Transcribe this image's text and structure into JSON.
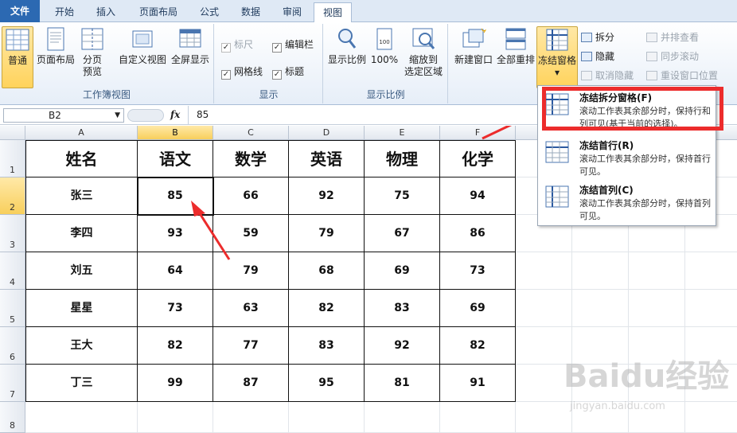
{
  "tabs": {
    "file": "文件",
    "items": [
      "开始",
      "插入",
      "页面布局",
      "公式",
      "数据",
      "审阅",
      "视图"
    ]
  },
  "ribbon": {
    "workbook_views": {
      "normal": "普通",
      "page_layout": "页面布局",
      "page_break_1": "分页",
      "page_break_2": "预览",
      "custom_views": "自定义视图",
      "full_screen": "全屏显示",
      "group_label": "工作簿视图"
    },
    "show": {
      "ruler": "标尺",
      "formula_bar": "编辑栏",
      "gridlines": "网格线",
      "headings": "标题",
      "group_label": "显示"
    },
    "zoom": {
      "zoom": "显示比例",
      "zoom100": "100%",
      "zoom_sel_1": "缩放到",
      "zoom_sel_2": "选定区域",
      "group_label": "显示比例"
    },
    "window": {
      "new_window": "新建窗口",
      "arrange_all": "全部重排",
      "freeze": "冻结窗格",
      "split": "拆分",
      "hide": "隐藏",
      "unhide": "取消隐藏",
      "side_by_side": "并排查看",
      "sync_scroll": "同步滚动",
      "reset_pos": "重设窗口位置"
    }
  },
  "formula_bar": {
    "name_box": "B2",
    "fx": "fx",
    "value": "85"
  },
  "columns": [
    "A",
    "B",
    "C",
    "D",
    "E",
    "F"
  ],
  "rows": [
    "1",
    "2",
    "3",
    "4",
    "5",
    "6",
    "7",
    "8"
  ],
  "table": {
    "headers": [
      "姓名",
      "语文",
      "数学",
      "英语",
      "物理",
      "化学"
    ],
    "rows": [
      [
        "张三",
        "85",
        "66",
        "92",
        "75",
        "94"
      ],
      [
        "李四",
        "93",
        "59",
        "79",
        "67",
        "86"
      ],
      [
        "刘五",
        "64",
        "79",
        "68",
        "69",
        "73"
      ],
      [
        "星星",
        "73",
        "63",
        "82",
        "83",
        "69"
      ],
      [
        "王大",
        "82",
        "77",
        "83",
        "92",
        "82"
      ],
      [
        "丁三",
        "99",
        "87",
        "95",
        "81",
        "91"
      ]
    ]
  },
  "freeze_menu": [
    {
      "title": "冻结拆分窗格(F)",
      "desc": "滚动工作表其余部分时，保持行和列可见(基于当前的选择)。"
    },
    {
      "title": "冻结首行(R)",
      "desc": "滚动工作表其余部分时，保持首行可见。"
    },
    {
      "title": "冻结首列(C)",
      "desc": "滚动工作表其余部分时，保持首列可见。"
    }
  ],
  "watermark": {
    "brand": "Baidu经验",
    "url": "jingyan.baidu.com"
  },
  "colors": {
    "accent": "#2c69b2",
    "highlight": "#ffd35c",
    "annotation": "#ec2c2c"
  }
}
